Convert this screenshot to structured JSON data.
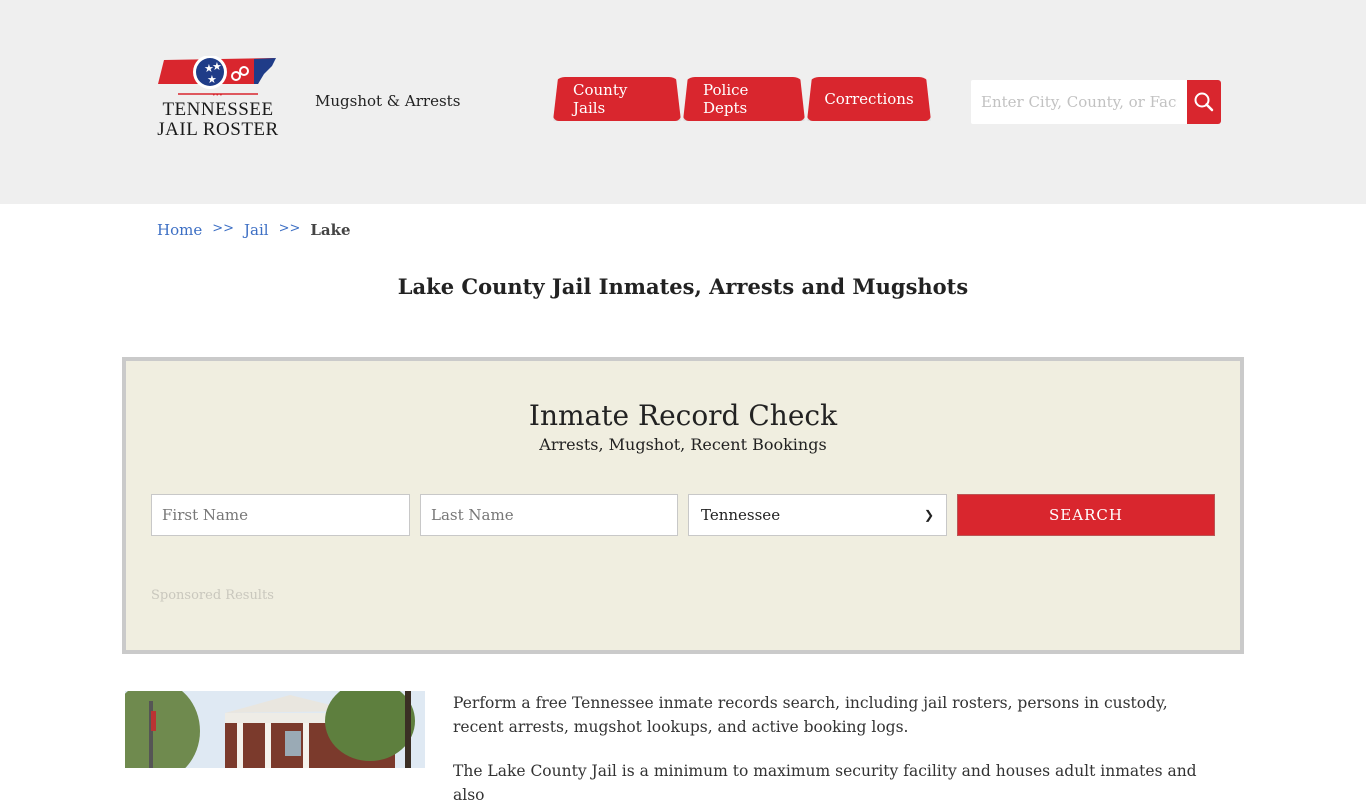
{
  "header": {
    "logo": {
      "line1": "TENNESSEE",
      "line2": "JAIL ROSTER",
      "colors": {
        "red": "#d9262e",
        "blue": "#1f3c88"
      }
    },
    "tagline": "Mugshot & Arrests",
    "nav": [
      {
        "label": "County Jails"
      },
      {
        "label": "Police Depts"
      },
      {
        "label": "Corrections"
      }
    ],
    "search": {
      "placeholder": "Enter City, County, or Facility",
      "icon": "search-icon"
    }
  },
  "breadcrumb": {
    "items": [
      {
        "label": "Home"
      },
      {
        "label": "Jail"
      }
    ],
    "separator": ">>",
    "current": "Lake"
  },
  "page_title": "Lake County Jail Inmates, Arrests and Mugshots",
  "record_check": {
    "title": "Inmate Record Check",
    "subtitle": "Arrests, Mugshot, Recent Bookings",
    "first_name_placeholder": "First Name",
    "last_name_placeholder": "Last Name",
    "state_selected": "Tennessee",
    "search_label": "SEARCH",
    "sponsored_label": "Sponsored Results"
  },
  "content": {
    "image_alt": "Lake County Jail building",
    "paragraph1": "Perform a free Tennessee inmate records search, including jail rosters, persons in custody, recent arrests, mugshot lookups, and active booking logs.",
    "paragraph2": "The Lake County Jail is a minimum to maximum security facility and houses adult inmates and also"
  },
  "colors": {
    "accent": "#d9262e",
    "link": "#3d6fc4",
    "panel_bg": "#f0eee0",
    "header_bg": "#efefef"
  }
}
